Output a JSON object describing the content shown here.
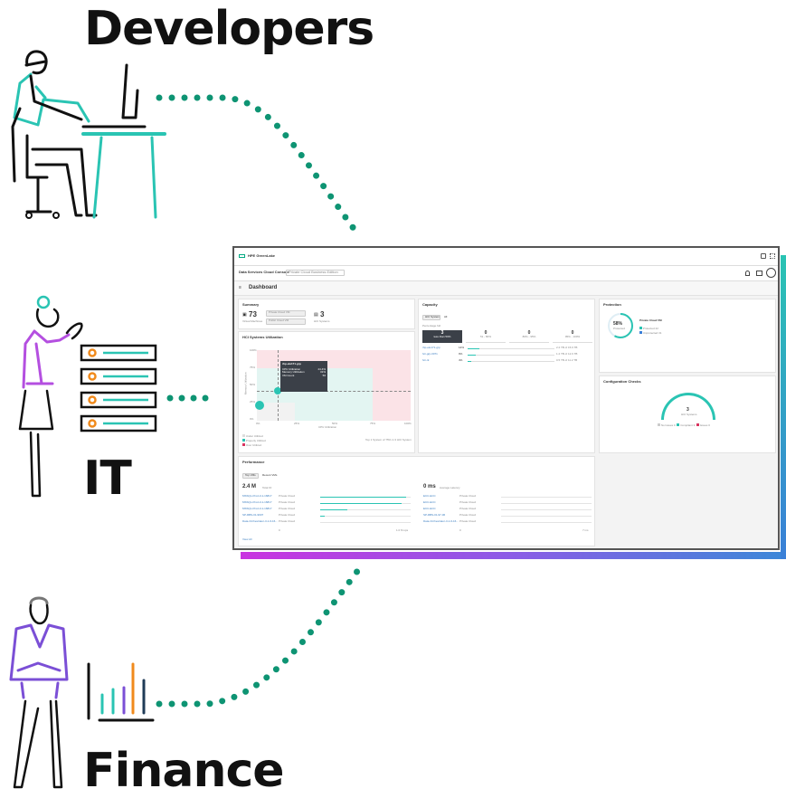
{
  "personas": {
    "developers": "Developers",
    "it": "IT",
    "finance": "Finance"
  },
  "colors": {
    "teal": "#2ac4b3",
    "dots": "#0e9473",
    "purple": "#b44fe0",
    "violet": "#7b4fd6",
    "orange": "#f08a1c",
    "navy": "#1f3b57"
  },
  "dashboard": {
    "brand": "HPE GreenLake",
    "console": "Data Services Cloud Console",
    "edition": "Private Cloud Business Edition",
    "page_title": "Dashboard",
    "summary": {
      "title": "Summary",
      "vm_count": "73",
      "vm_label": "Virtual Machines",
      "chip1": "Private Cloud VM",
      "chip2": "Public Cloud VM",
      "systems_count": "3",
      "systems_label": "HCI Systems"
    },
    "capacity": {
      "title": "Capacity",
      "tab1": "HCI System",
      "tab2": "All",
      "sub": "Percentage full",
      "buckets": [
        {
          "value": "3",
          "label": "less than 50%"
        },
        {
          "value": "0",
          "label": "51 - 80%"
        },
        {
          "value": "0",
          "label": "80% - 95%"
        },
        {
          "value": "0",
          "label": "95% - 100%"
        }
      ],
      "rows": [
        {
          "name": "rhp-ele171-grp",
          "pct": "14%",
          "value": "2.2 TB of 15.6 TB"
        },
        {
          "name": "hci-grp-0071",
          "pct": "9%",
          "value": "1.2 TB of 12.6 TB"
        },
        {
          "name": "hci-rk",
          "pct": "4%",
          "value": "0.5 TB of 11.2 TB"
        }
      ]
    },
    "protection": {
      "title": "Protection",
      "percent": "58%",
      "pct_label": "Protected",
      "subtitle": "Private Cloud VM",
      "legend": [
        {
          "label": "Protected",
          "count": "42"
        },
        {
          "label": "Unprotected",
          "count": "31"
        }
      ],
      "progress": 0.58
    },
    "utilization": {
      "title": "HCI Systems Utilization",
      "tooltip_name": "rhp-ele171-grp",
      "tooltip_rows": [
        {
          "k": "CPU Utilization",
          "v": "24.4%"
        },
        {
          "k": "Memory Utilization",
          "v": "31%"
        },
        {
          "k": "VM Count",
          "v": "56"
        }
      ],
      "y_ticks": [
        "100%",
        "75%",
        "50%",
        "25%",
        "0%"
      ],
      "x_ticks": [
        "0%",
        "25%",
        "50%",
        "75%",
        "100%"
      ],
      "x_label": "CPU Utilization",
      "y_label": "Memory Utilization",
      "legend": [
        "Under Utilized",
        "Properly Utilized",
        "Over Utilized"
      ],
      "footnote": "Top 1 System of 75% in 3 HCI System"
    },
    "config": {
      "title": "Configuration Checks",
      "value": "3",
      "label": "HCI Systems",
      "legend": [
        {
          "label": "No Issues",
          "count": "0"
        },
        {
          "label": "Compliant",
          "count": "3"
        },
        {
          "label": "Issues",
          "count": "0"
        }
      ]
    },
    "performance": {
      "title": "Performance",
      "tab1": "Top VMs",
      "tab2": "Recent VMs",
      "left_value": "2.4 M",
      "left_label": "Total IO",
      "right_value": "0 ms",
      "right_label": "Average Latency",
      "left_rows": [
        {
          "name": "MSSQL-Prod-3-1-16817",
          "type": "Private Cloud",
          "fill": 0.95
        },
        {
          "name": "MSSQL-Prod-3-1-16817",
          "type": "Private Cloud",
          "fill": 0.9
        },
        {
          "name": "MSSQL-Prod-3-1-16817",
          "type": "Private Cloud",
          "fill": 0.3
        },
        {
          "name": "SP-RBS-01-9907",
          "type": "Private Cloud",
          "fill": 0.05
        },
        {
          "name": "Data-Orchestrator-3-1-6-16...",
          "type": "Private Cloud",
          "fill": 0.0
        }
      ],
      "right_rows": [
        {
          "name": "ECC-ECC",
          "type": "Private Cloud"
        },
        {
          "name": "ECC-ECC",
          "type": "Private Cloud"
        },
        {
          "name": "ECC-ECC",
          "type": "Private Cloud"
        },
        {
          "name": "SP-RBS-01-97-06",
          "type": "Private Cloud"
        },
        {
          "name": "Data-Orchestrator-3-1-6-16...",
          "type": "Private Cloud"
        }
      ],
      "axis_left": [
        "0",
        "1.0 M ops"
      ],
      "axis_right": [
        "0",
        "7 ms"
      ],
      "view_all": "View All"
    }
  }
}
